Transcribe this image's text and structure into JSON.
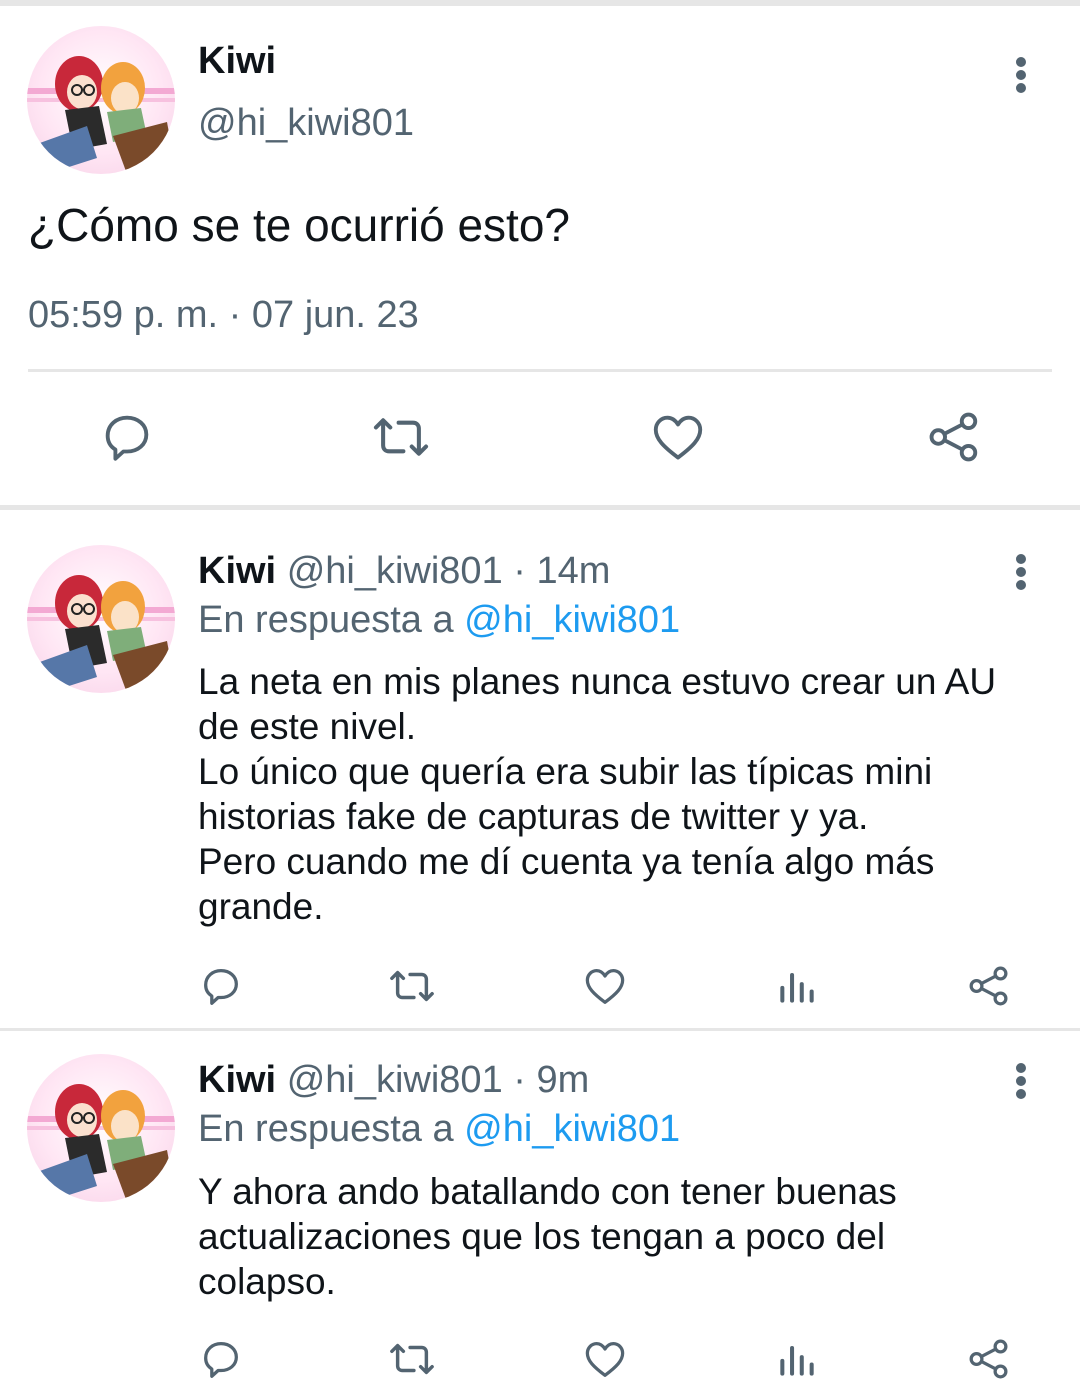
{
  "main_tweet": {
    "name": "Kiwi",
    "handle": "@hi_kiwi801",
    "text": "¿Cómo se te ocurrió esto?",
    "timestamp": "05:59 p. m. · 07 jun. 23"
  },
  "replies": [
    {
      "name": "Kiwi",
      "handle": "@hi_kiwi801",
      "time": "· 14m",
      "reply_prefix": "En respuesta a ",
      "reply_to": "@hi_kiwi801",
      "lines": [
        "La neta en mis planes nunca estuvo crear un AU",
        "de este nivel.",
        "Lo único que quería era subir las típicas mini",
        "historias fake de capturas de twitter y ya.",
        "Pero cuando me dí cuenta ya tenía algo más",
        "grande."
      ]
    },
    {
      "name": "Kiwi",
      "handle": "@hi_kiwi801",
      "time": "· 9m",
      "reply_prefix": "En respuesta a ",
      "reply_to": "@hi_kiwi801",
      "lines": [
        "Y ahora ando batallando con tener buenas",
        "actualizaciones que los tengan a poco del",
        "colapso."
      ]
    }
  ],
  "icons": {
    "reply": "reply-icon",
    "retweet": "retweet-icon",
    "like": "heart-icon",
    "views": "views-icon",
    "share": "share-icon",
    "more": "more-icon"
  },
  "colors": {
    "text": "#0f1419",
    "secondary": "#536471",
    "link": "#1d9bf0",
    "divider": "#e6e6e6"
  }
}
